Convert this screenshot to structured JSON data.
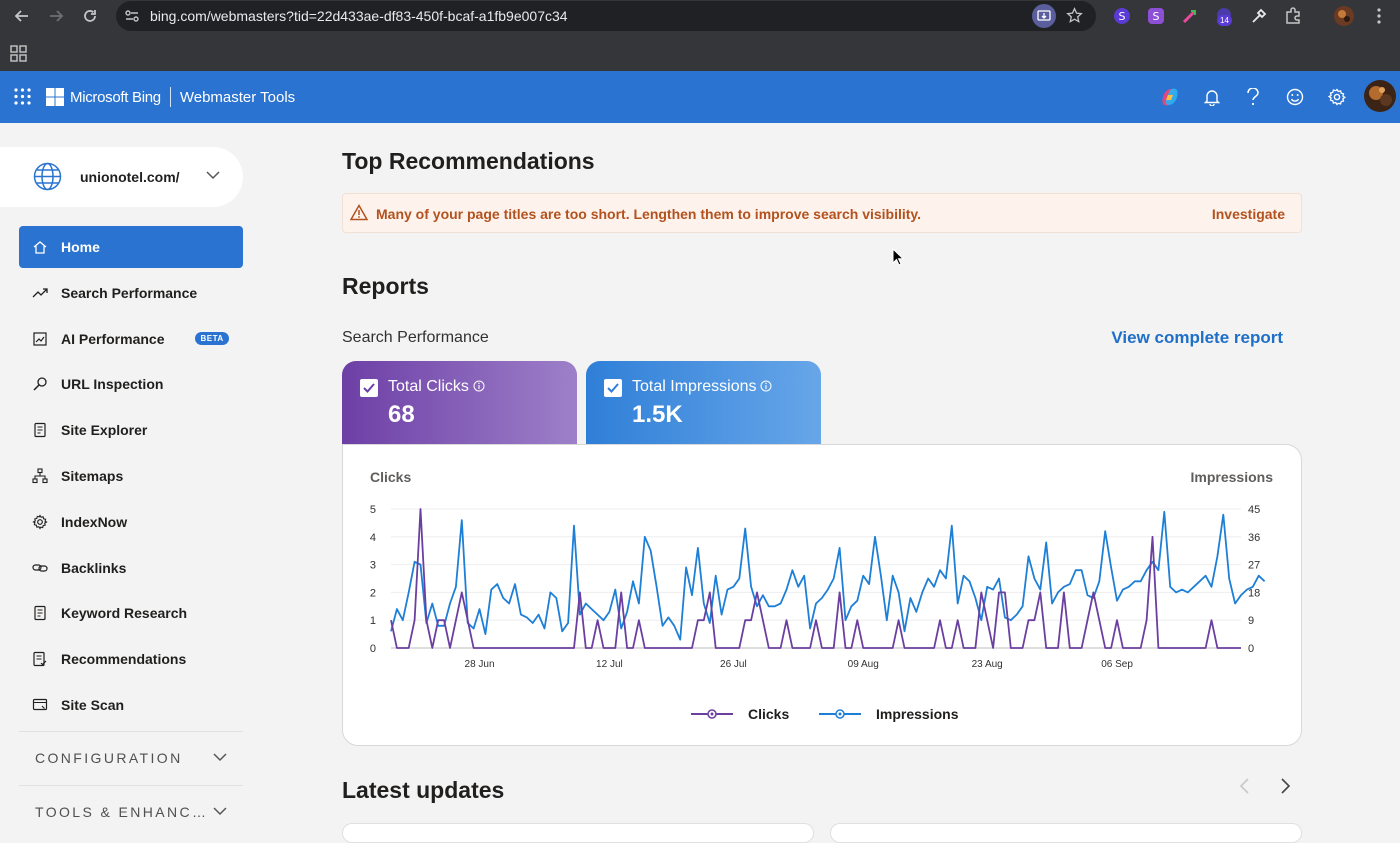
{
  "browser": {
    "url": "bing.com/webmasters?tid=22d433ae-df83-450f-bcaf-a1fb9e007c34",
    "extension_badge": "14"
  },
  "header": {
    "brand": "Microsoft Bing",
    "product": "Webmaster Tools"
  },
  "sidebar": {
    "site": "unionotel.com/",
    "items": [
      {
        "label": "Home",
        "icon": "home-icon",
        "active": true
      },
      {
        "label": "Search Performance",
        "icon": "trend-icon"
      },
      {
        "label": "AI Performance",
        "icon": "ai-chart-icon",
        "badge": "BETA"
      },
      {
        "label": "URL Inspection",
        "icon": "magnifier-icon"
      },
      {
        "label": "Site Explorer",
        "icon": "document-icon"
      },
      {
        "label": "Sitemaps",
        "icon": "sitemap-icon"
      },
      {
        "label": "IndexNow",
        "icon": "gear-icon"
      },
      {
        "label": "Backlinks",
        "icon": "link-icon"
      },
      {
        "label": "Keyword Research",
        "icon": "document-icon"
      },
      {
        "label": "Recommendations",
        "icon": "checklist-icon"
      },
      {
        "label": "Site Scan",
        "icon": "scan-icon"
      }
    ],
    "sections": [
      {
        "label": "CONFIGURATION"
      },
      {
        "label": "TOOLS & ENHANC…"
      }
    ]
  },
  "main": {
    "top_title": "Top Recommendations",
    "recommendation": {
      "text": "Many of your page titles are too short. Lengthen them to improve search visibility.",
      "action": "Investigate"
    },
    "reports_title": "Reports",
    "search_performance_label": "Search Performance",
    "view_report": "View complete report",
    "clicks_card": {
      "label": "Total Clicks",
      "value": "68"
    },
    "impressions_card": {
      "label": "Total Impressions",
      "value": "1.5K"
    },
    "latest_updates": "Latest updates"
  },
  "colors": {
    "accent": "#2b73d1",
    "clicks": "#6b3fa0",
    "impressions": "#1e7fd6",
    "warning": "#b3521e"
  },
  "chart_data": {
    "type": "line",
    "left_axis_label": "Clicks",
    "right_axis_label": "Impressions",
    "left_ticks": [
      "5",
      "4",
      "3",
      "2",
      "1",
      "0"
    ],
    "right_ticks": [
      "45",
      "36",
      "27",
      "18",
      "9",
      "0"
    ],
    "x_tick_labels": [
      "28 Jun",
      "12 Jul",
      "26 Jul",
      "09 Aug",
      "23 Aug",
      "06 Sep"
    ],
    "x_tick_index": [
      10,
      24,
      38,
      52,
      66,
      80
    ],
    "ylim_left": [
      0,
      5
    ],
    "ylim_right": [
      0,
      45
    ],
    "legend": [
      "Clicks",
      "Impressions"
    ],
    "series": [
      {
        "name": "Clicks",
        "axis": "left",
        "values": [
          1,
          0,
          0,
          0,
          1,
          5,
          1,
          0,
          1,
          1,
          0,
          1,
          2,
          1,
          0,
          0,
          0,
          0,
          0,
          0,
          0,
          0,
          0,
          0,
          0,
          0,
          0,
          0,
          0,
          0,
          0,
          0,
          2,
          0,
          0,
          1,
          0,
          0,
          0,
          2,
          0,
          0,
          1,
          0,
          0,
          0,
          0,
          0,
          0,
          0,
          0,
          0,
          1,
          1,
          2,
          0,
          0,
          0,
          0,
          0,
          1,
          1,
          2,
          1,
          0,
          0,
          0,
          1,
          0,
          0,
          0,
          0,
          1,
          0,
          0,
          0,
          2,
          0,
          0,
          1,
          0,
          0,
          0,
          0,
          0,
          0,
          1,
          0,
          0,
          0,
          0,
          0,
          0,
          1,
          0,
          0,
          1,
          0,
          0,
          0,
          2,
          1,
          0,
          2,
          2,
          0,
          0,
          0,
          1,
          1,
          2,
          0,
          0,
          0,
          2,
          0,
          0,
          0,
          1,
          2,
          1,
          0,
          0,
          1,
          0,
          0,
          0,
          0,
          1,
          4,
          0,
          0,
          0,
          0,
          0,
          0,
          0,
          0,
          0,
          1,
          0,
          0,
          0,
          0,
          0
        ]
      },
      {
        "name": "Impressions",
        "axis": "left",
        "values": [
          0.6,
          1.4,
          1.0,
          2.0,
          3.1,
          3.0,
          0.9,
          1.6,
          0.8,
          0.8,
          1.6,
          2.2,
          4.6,
          0.9,
          0.7,
          1.4,
          0.5,
          2.1,
          2.3,
          1.8,
          1.6,
          2.3,
          1.2,
          1.1,
          0.9,
          1.2,
          0.7,
          2.0,
          1.8,
          0.6,
          0.9,
          4.4,
          1.2,
          1.6,
          1.4,
          1.2,
          1.0,
          1.3,
          2.1,
          0.7,
          1.3,
          2.4,
          1.6,
          4.0,
          3.5,
          2.2,
          0.8,
          1.1,
          0.8,
          0.3,
          2.9,
          1.9,
          3.6,
          1.6,
          0.9,
          2.6,
          1.2,
          2.1,
          2.2,
          2.5,
          4.3,
          2.2,
          1.5,
          1.9,
          1.5,
          1.5,
          1.6,
          2.1,
          2.8,
          2.2,
          2.6,
          0.7,
          1.6,
          1.8,
          2.1,
          2.5,
          3.6,
          1.0,
          1.5,
          1.7,
          2.6,
          2.3,
          4.0,
          2.6,
          1.0,
          2.6,
          2.0,
          0.6,
          1.8,
          1.3,
          2.0,
          2.5,
          2.2,
          2.8,
          2.5,
          4.4,
          1.6,
          2.6,
          2.4,
          1.8,
          1.0,
          2.2,
          2.1,
          2.5,
          1.1,
          1.0,
          1.2,
          1.5,
          3.3,
          2.5,
          2.1,
          3.8,
          1.6,
          2.0,
          2.2,
          2.3,
          2.8,
          2.8,
          1.9,
          1.8,
          2.4,
          4.2,
          2.9,
          1.7,
          2.1,
          2.2,
          2.4,
          2.4,
          2.8,
          3.1,
          2.8,
          4.9,
          2.2,
          2.0,
          2.1,
          2.0,
          2.2,
          2.4,
          2.6,
          2.2,
          3.3,
          4.8,
          2.5,
          1.6,
          1.9,
          2.1,
          2.2,
          2.6,
          2.4
        ]
      }
    ]
  }
}
